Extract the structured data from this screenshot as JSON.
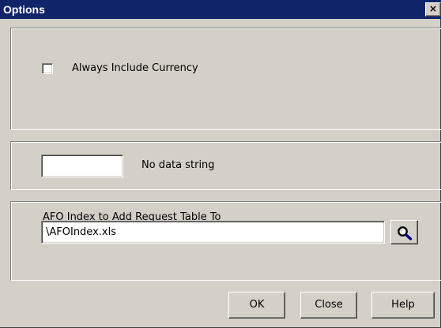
{
  "window": {
    "title": "Options",
    "close_label": "×"
  },
  "currency": {
    "checked": false,
    "label": "Always Include Currency"
  },
  "no_data": {
    "value": "",
    "label": "No data string"
  },
  "afo_index": {
    "label": "AFO Index to Add Request Table To",
    "value": "\\AFOIndex.xls",
    "browse_icon": "magnifier-icon"
  },
  "buttons": {
    "ok": "OK",
    "close": "Close",
    "help": "Help"
  },
  "colors": {
    "titlebar": "#10246a",
    "dialog_bg": "#d4d0c8"
  }
}
